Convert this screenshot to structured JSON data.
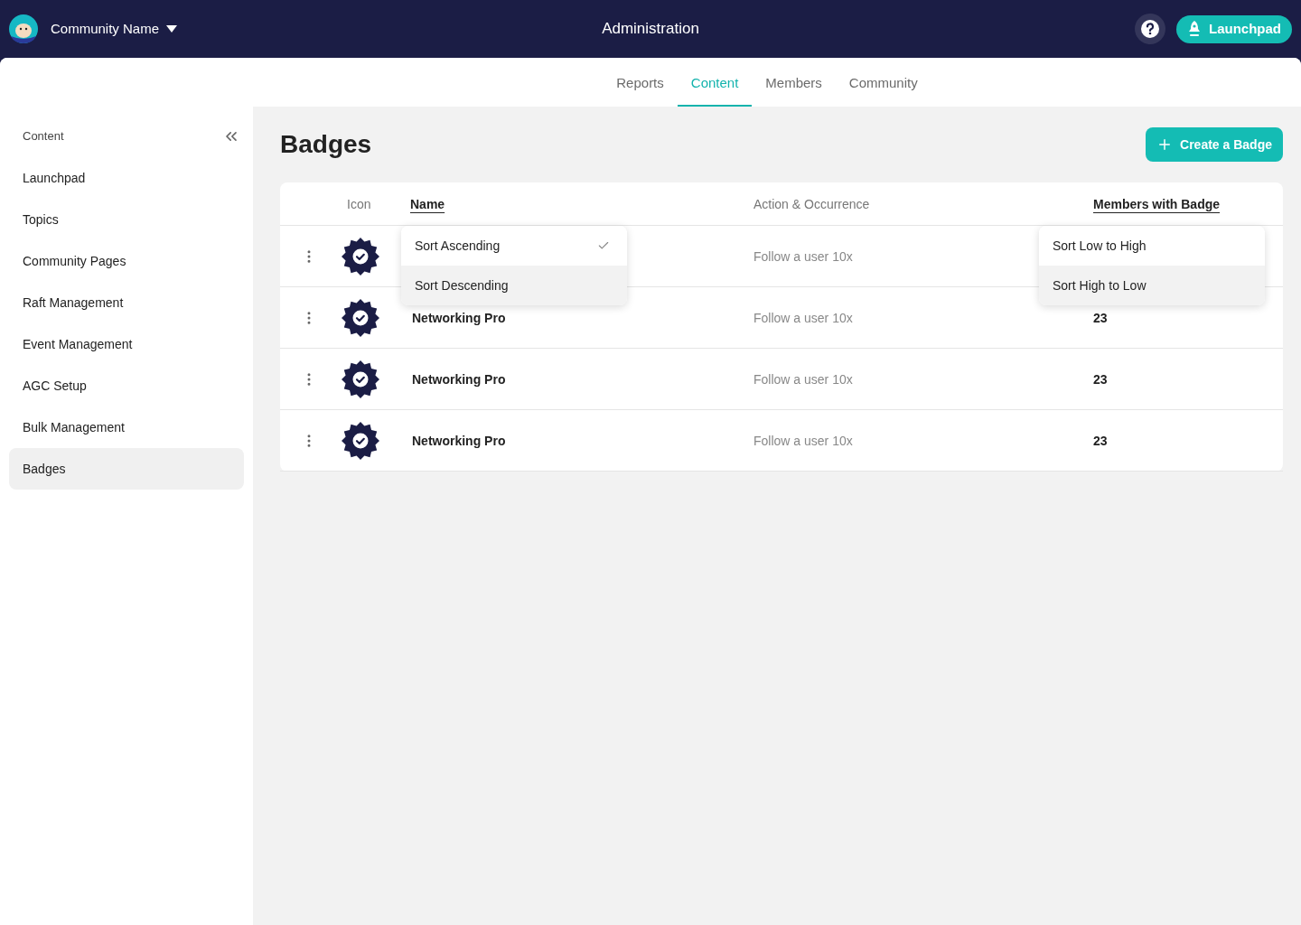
{
  "topbar": {
    "community_name": "Community Name",
    "title": "Administration",
    "launchpad_button": "Launchpad"
  },
  "tabs": [
    {
      "label": "Reports",
      "selected": false
    },
    {
      "label": "Content",
      "selected": true
    },
    {
      "label": "Members",
      "selected": false
    },
    {
      "label": "Community",
      "selected": false
    }
  ],
  "sidebar": {
    "heading": "Content",
    "items": [
      {
        "label": "Launchpad",
        "selected": false
      },
      {
        "label": "Topics",
        "selected": false
      },
      {
        "label": "Community Pages",
        "selected": false
      },
      {
        "label": "Raft Management",
        "selected": false
      },
      {
        "label": "Event Management",
        "selected": false
      },
      {
        "label": "AGC Setup",
        "selected": false
      },
      {
        "label": "Bulk Management",
        "selected": false
      },
      {
        "label": "Badges",
        "selected": true
      }
    ]
  },
  "page": {
    "title": "Badges",
    "create_button": "Create a Badge"
  },
  "table": {
    "columns": [
      {
        "label": "Icon",
        "sortable": false
      },
      {
        "label": "Name",
        "sortable": true
      },
      {
        "label": "Action & Occurrence",
        "sortable": false
      },
      {
        "label": "Members with Badge",
        "sortable": true
      }
    ],
    "rows": [
      {
        "action": "Follow a user 10x"
      },
      {
        "name": "Networking Pro",
        "action": "Follow a user 10x",
        "members": "23"
      },
      {
        "name": "Networking Pro",
        "action": "Follow a user 10x",
        "members": "23"
      },
      {
        "name": "Networking Pro",
        "action": "Follow a user 10x",
        "members": "23"
      }
    ]
  },
  "name_sort_menu": [
    {
      "label": "Sort Ascending",
      "checked": true,
      "highlighted": false
    },
    {
      "label": "Sort Descending",
      "checked": false,
      "highlighted": true
    }
  ],
  "members_sort_menu": [
    {
      "label": "Sort Low to High",
      "checked": false,
      "highlighted": false
    },
    {
      "label": "Sort High to Low",
      "checked": false,
      "highlighted": true
    }
  ]
}
